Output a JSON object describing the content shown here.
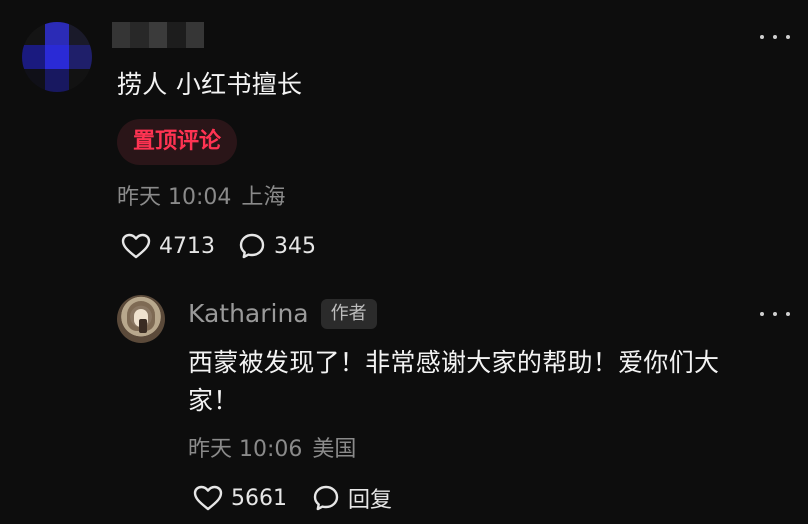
{
  "top_comment": {
    "text": "捞人 小红书擅长",
    "pinned_label": "置顶评论",
    "meta": {
      "time": "昨天 10:04",
      "location": "上海"
    },
    "likes": "4713",
    "comments": "345",
    "avatar_colors": [
      "#141414",
      "#2b2bb6",
      "#1a1a2a",
      "#1a1a7f",
      "#2a2ad6",
      "#1f1f6a",
      "#101018",
      "#181860",
      "#121212"
    ],
    "name_colors": [
      "#3a3a3a",
      "#2b2b2b",
      "#404040",
      "#1f1f1f",
      "#3b3b3b"
    ]
  },
  "reply": {
    "author": "Katharina",
    "author_badge": "作者",
    "text_line1": "西蒙被发现了！非常感谢大家的帮助！爱你们大",
    "text_line2": "家！",
    "meta": {
      "time": "昨天 10:06",
      "location": "美国"
    },
    "likes": "5661",
    "reply_label": "回复"
  },
  "icons": {
    "more": "more-icon",
    "like": "heart-icon",
    "comment": "comment-bubble-icon"
  }
}
